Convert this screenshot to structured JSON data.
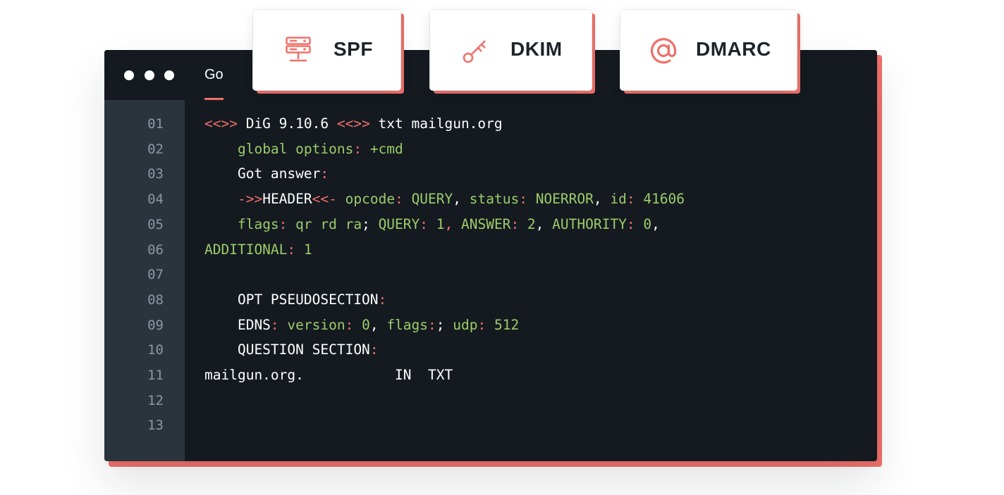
{
  "window": {
    "tab_label": "Go"
  },
  "badges": [
    {
      "label": "SPF",
      "icon": "server-icon"
    },
    {
      "label": "DKIM",
      "icon": "key-icon"
    },
    {
      "label": "DMARC",
      "icon": "at-sign-icon"
    }
  ],
  "colors": {
    "accent": "#f0706a",
    "editor_bg": "#141a20",
    "gutter_bg": "#2a343d",
    "green": "#9ccc6a"
  },
  "code": {
    "line_numbers": [
      "01",
      "02",
      "03",
      "04",
      "05",
      "06",
      "07",
      "08",
      "09",
      "10",
      "11",
      "12",
      "13"
    ],
    "lines": [
      [
        [
          "r",
          "<<>> "
        ],
        [
          "w",
          "DiG 9.10.6 "
        ],
        [
          "r",
          "<<>> "
        ],
        [
          "w",
          "txt mailgun.org"
        ]
      ],
      [
        [
          "w",
          "    "
        ],
        [
          "g",
          "global options"
        ],
        [
          "r",
          ": "
        ],
        [
          "g",
          "+cmd"
        ]
      ],
      [
        [
          "w",
          "    Got answer"
        ],
        [
          "r",
          ":"
        ]
      ],
      [
        [
          "w",
          "    "
        ],
        [
          "r",
          "->>"
        ],
        [
          "w",
          "HEADER"
        ],
        [
          "r",
          "<<- "
        ],
        [
          "g",
          "opcode"
        ],
        [
          "r",
          ": "
        ],
        [
          "g",
          "QUERY"
        ],
        [
          "w",
          ", "
        ],
        [
          "g",
          "status"
        ],
        [
          "r",
          ": "
        ],
        [
          "g",
          "NOERROR"
        ],
        [
          "w",
          ", "
        ],
        [
          "g",
          "id"
        ],
        [
          "r",
          ": "
        ],
        [
          "g",
          "41606"
        ]
      ],
      [
        [
          "w",
          "    "
        ],
        [
          "g",
          "flags"
        ],
        [
          "r",
          ": "
        ],
        [
          "g",
          "qr rd ra"
        ],
        [
          "w",
          "; "
        ],
        [
          "g",
          "QUERY"
        ],
        [
          "r",
          ": "
        ],
        [
          "g",
          "1"
        ],
        [
          "r",
          ", "
        ],
        [
          "g",
          "ANSWER"
        ],
        [
          "r",
          ": "
        ],
        [
          "g",
          "2"
        ],
        [
          "w",
          ", "
        ],
        [
          "g",
          "AUTHORITY"
        ],
        [
          "r",
          ": "
        ],
        [
          "g",
          "0"
        ],
        [
          "w",
          ","
        ]
      ],
      [
        [
          "g",
          "ADDITIONAL"
        ],
        [
          "r",
          ": "
        ],
        [
          "g",
          "1"
        ]
      ],
      [],
      [
        [
          "w",
          "    OPT PSEUDOSECTION"
        ],
        [
          "r",
          ":"
        ]
      ],
      [
        [
          "w",
          "    EDNS"
        ],
        [
          "r",
          ": "
        ],
        [
          "g",
          "version"
        ],
        [
          "r",
          ": "
        ],
        [
          "g",
          "0"
        ],
        [
          "w",
          ", "
        ],
        [
          "g",
          "flags"
        ],
        [
          "r",
          ":"
        ],
        [
          "w",
          "; "
        ],
        [
          "g",
          "udp"
        ],
        [
          "r",
          ": "
        ],
        [
          "g",
          "512"
        ]
      ],
      [
        [
          "w",
          "    QUESTION SECTION"
        ],
        [
          "r",
          ":"
        ]
      ],
      [
        [
          "w",
          "mailgun.org.           IN  TXT"
        ]
      ],
      [],
      []
    ]
  }
}
